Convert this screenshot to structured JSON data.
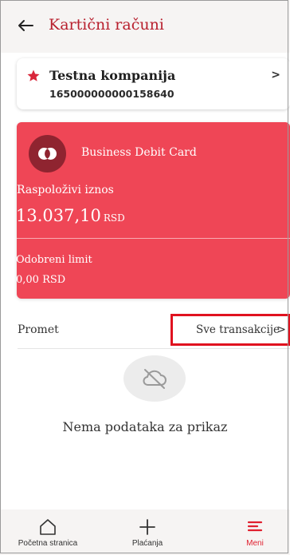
{
  "header": {
    "title": "Kartični računi"
  },
  "account": {
    "name": "Testna kompanija",
    "number": "165000000000158640",
    "chevron": ">"
  },
  "card": {
    "name": "Business Debit Card",
    "available_label": "Raspoloživi iznos",
    "available_amount": "13.037,10",
    "available_currency": "RSD",
    "limit_label": "Odobreni limit",
    "limit_value": "0,00 RSD"
  },
  "transactions": {
    "section_label": "Promet",
    "all_link": "Sve transakcije",
    "chevron": ">",
    "empty_text": "Nema podataka za prikaz"
  },
  "bottom_nav": {
    "items": [
      {
        "label": "Početna stranica",
        "icon": "home-icon"
      },
      {
        "label": "Plaćanja",
        "icon": "plus-icon"
      },
      {
        "label": "Meni",
        "icon": "menu-icon"
      }
    ]
  },
  "colors": {
    "brand_red": "#b8202e",
    "card_red": "#ef4656",
    "highlight_box": "#e0121f"
  }
}
